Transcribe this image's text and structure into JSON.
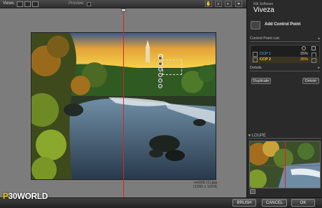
{
  "toolbar": {
    "views_label": "Views",
    "preview_label": "Preview"
  },
  "image": {
    "filename": "viv036 (1).jpg",
    "dimensions": "(1280 x 1024)"
  },
  "panel": {
    "brand_small": "Nik Software",
    "brand": "Viveza",
    "add_control_point": "Add Control Point",
    "control_point_list": "Control Point List",
    "control_points": [
      {
        "name": "CCP 1",
        "percent": "25%",
        "color": "#4fc3f7"
      },
      {
        "name": "CCP 2",
        "percent": "25%",
        "color": "#ffcc33"
      }
    ],
    "details": "Details",
    "duplicate": "Duplicate",
    "delete": "Delete",
    "loupe": "LOUPE"
  },
  "footer": {
    "brush": "BRUSH",
    "cancel": "CANCEL",
    "ok": "OK"
  },
  "watermark": {
    "prefix": "P",
    "rest": "30WORLD"
  },
  "colors": {
    "split_line": "#dd2222",
    "accent_blue": "#4fc3f7",
    "accent_yellow": "#ffcc33"
  }
}
